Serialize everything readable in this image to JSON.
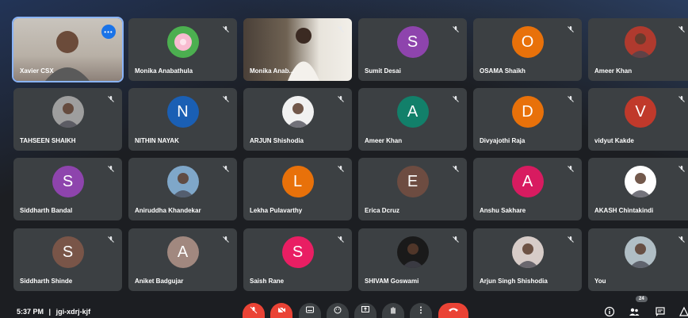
{
  "participants": [
    {
      "name": "Xavier CSX",
      "type": "video",
      "active": true
    },
    {
      "name": "Monika Anabathula",
      "type": "flower"
    },
    {
      "name": "Monika Anab...",
      "type": "video2"
    },
    {
      "name": "Sumit Desai",
      "type": "letter",
      "letter": "S",
      "color": "#8e44ad"
    },
    {
      "name": "OSAMA Shaikh",
      "type": "letter",
      "letter": "O",
      "color": "#e8710a"
    },
    {
      "name": "Ameer Khan",
      "type": "photo",
      "color": "#b03a2e"
    },
    {
      "name": "TAHSEEN SHAIKH",
      "type": "photo",
      "color": "#9e9e9e"
    },
    {
      "name": "NITHIN NAYAK",
      "type": "letter",
      "letter": "N",
      "color": "#1a5fb4"
    },
    {
      "name": "ARJUN Shishodia",
      "type": "photo",
      "color": "#f1f1f1"
    },
    {
      "name": "Ameer Khan",
      "type": "letter",
      "letter": "A",
      "color": "#12806a"
    },
    {
      "name": "Divyajothi Raja",
      "type": "letter",
      "letter": "D",
      "color": "#e8710a"
    },
    {
      "name": "vidyut Kakde",
      "type": "letter",
      "letter": "V",
      "color": "#c0392b"
    },
    {
      "name": "Siddharth Bandal",
      "type": "letter",
      "letter": "S",
      "color": "#8e44ad"
    },
    {
      "name": "Aniruddha Khandekar",
      "type": "photo",
      "color": "#7fa7c9"
    },
    {
      "name": "Lekha Pulavarthy",
      "type": "letter",
      "letter": "L",
      "color": "#e8710a"
    },
    {
      "name": "Erica Dcruz",
      "type": "letter",
      "letter": "E",
      "color": "#6d4c41"
    },
    {
      "name": "Anshu Sakhare",
      "type": "letter",
      "letter": "A",
      "color": "#d81b60"
    },
    {
      "name": "AKASH Chintakindi",
      "type": "photo",
      "color": "#ffffff"
    },
    {
      "name": "Siddharth Shinde",
      "type": "letter",
      "letter": "S",
      "color": "#795548"
    },
    {
      "name": "Aniket Badgujar",
      "type": "letter",
      "letter": "A",
      "color": "#a1887f"
    },
    {
      "name": "Saish Rane",
      "type": "letter",
      "letter": "S",
      "color": "#e91e63"
    },
    {
      "name": "SHIVAM Goswami",
      "type": "photo",
      "color": "#1a1a1a"
    },
    {
      "name": "Arjun Singh Shishodia",
      "type": "photo",
      "color": "#d7ccc8"
    },
    {
      "name": "You",
      "type": "photo",
      "color": "#b0bec5"
    }
  ],
  "footer": {
    "time": "5:37 PM",
    "separator": "|",
    "meeting_code": "jgi-xdrj-kjf",
    "people_count": "24"
  },
  "more_options_label": "•••",
  "colors": {
    "tile": "#3c4043",
    "accent": "#8ab4f8",
    "red": "#ea4335"
  }
}
